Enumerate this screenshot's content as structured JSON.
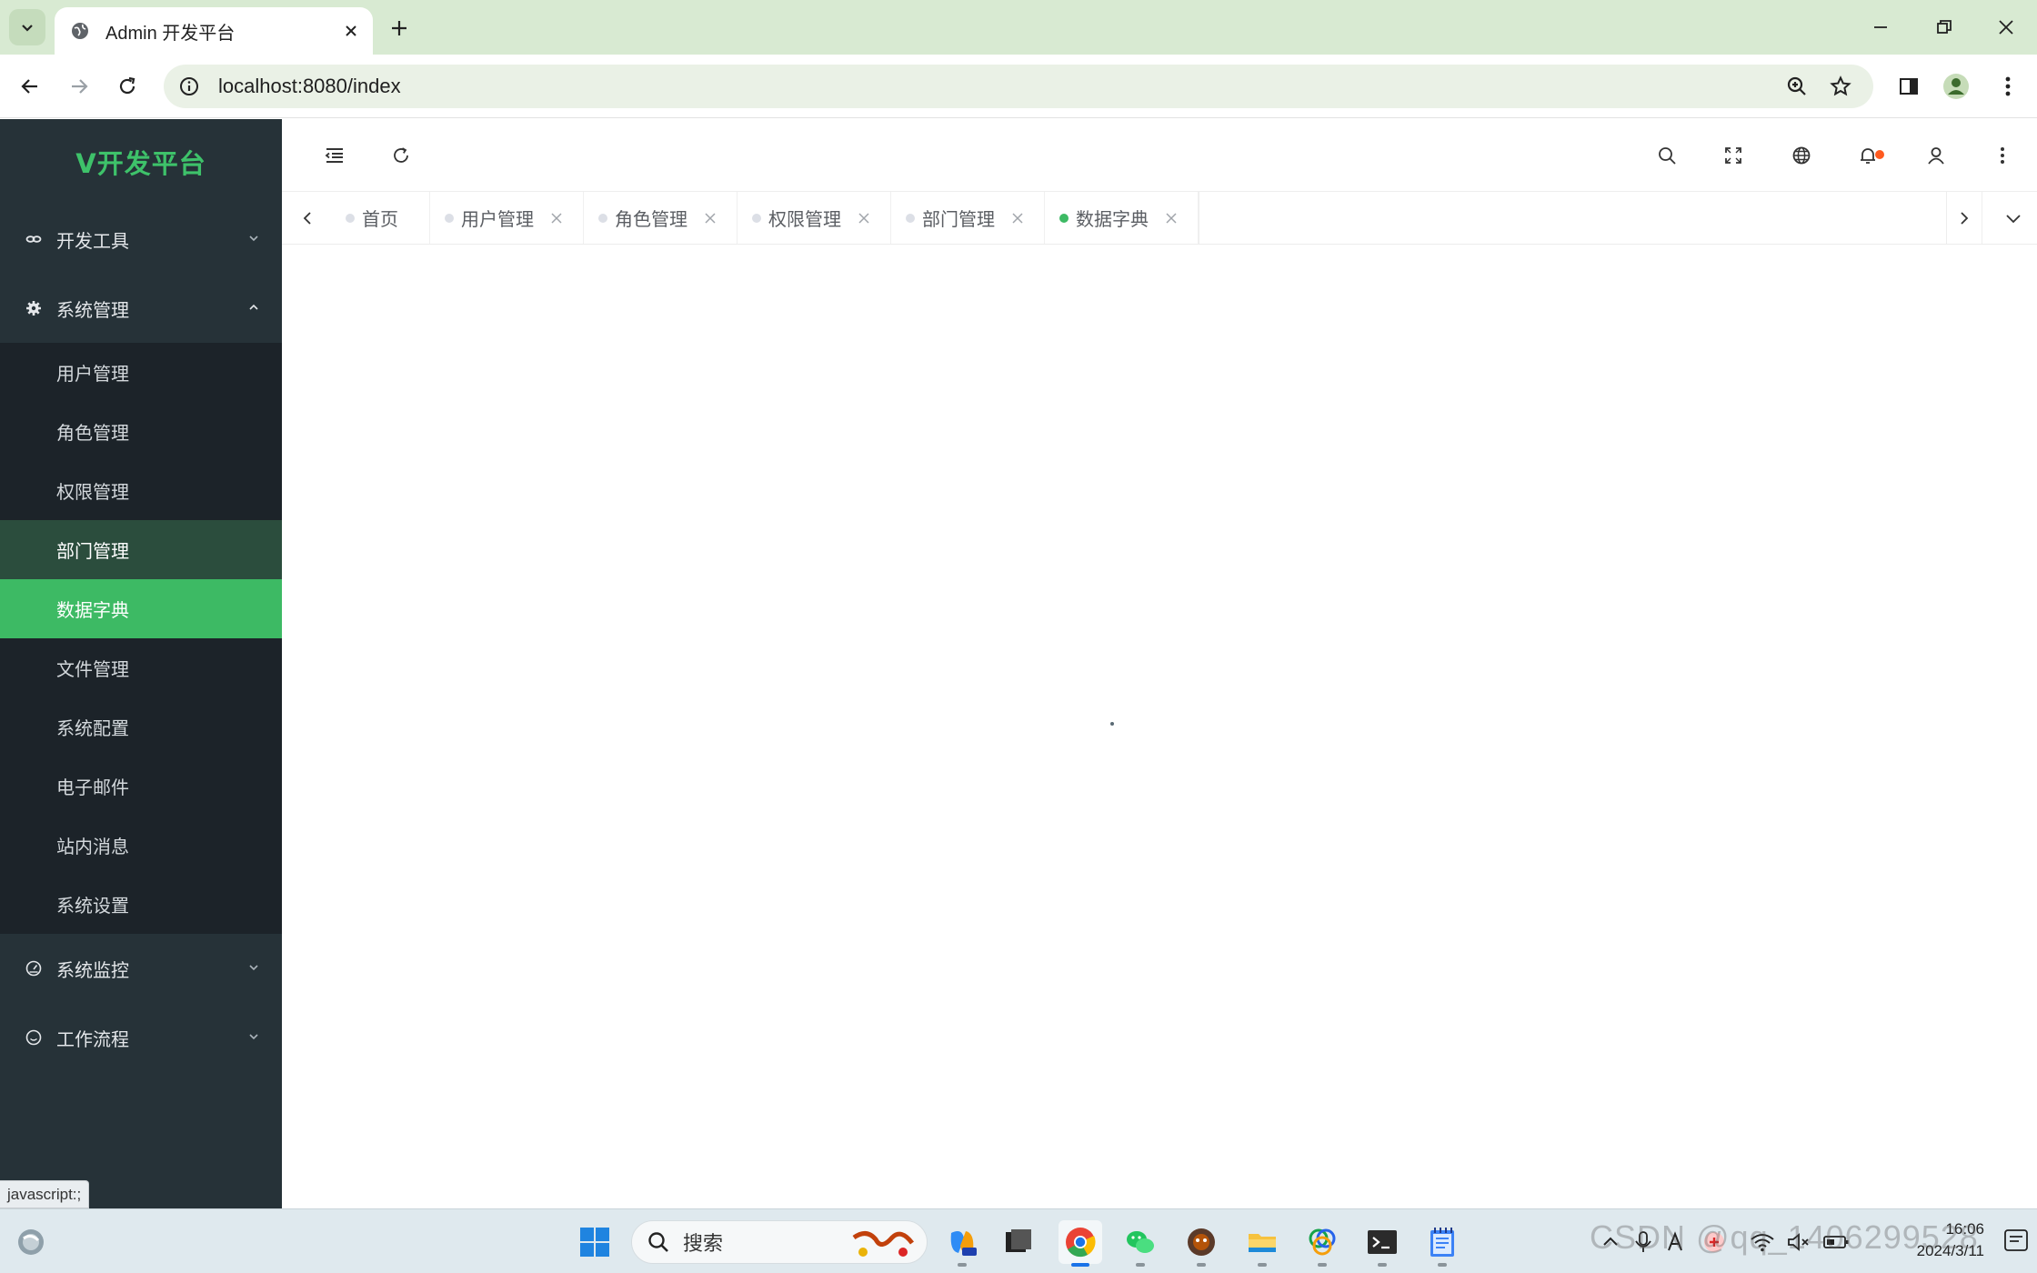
{
  "browser": {
    "tab_title": "Admin 开发平台",
    "url": "localhost:8080/index"
  },
  "sidebar": {
    "logo": "V开发平台",
    "groups": [
      {
        "label": "开发工具",
        "icon": "link-icon",
        "expanded": false
      },
      {
        "label": "系统管理",
        "icon": "gear-icon",
        "expanded": true
      },
      {
        "label": "系统监控",
        "icon": "dashboard-icon",
        "expanded": false
      },
      {
        "label": "工作流程",
        "icon": "smile-icon",
        "expanded": false
      }
    ],
    "system_items": [
      "用户管理",
      "角色管理",
      "权限管理",
      "部门管理",
      "数据字典",
      "文件管理",
      "系统配置",
      "电子邮件",
      "站内消息",
      "系统设置"
    ],
    "active_item": "数据字典",
    "hover_item": "部门管理"
  },
  "tags": [
    {
      "label": "首页",
      "closable": false
    },
    {
      "label": "用户管理",
      "closable": true
    },
    {
      "label": "角色管理",
      "closable": true
    },
    {
      "label": "权限管理",
      "closable": true
    },
    {
      "label": "部门管理",
      "closable": true
    },
    {
      "label": "数据字典",
      "closable": true,
      "active": true
    }
  ],
  "status_hint": "javascript:;",
  "taskbar": {
    "search_placeholder": "搜索",
    "time": "16:06",
    "date": "2024/3/11"
  },
  "watermark": "CSDN @qq_1406299528",
  "colors": {
    "accent": "#3dba64",
    "sidebar_bg": "#263238",
    "submenu_bg": "#1c2329",
    "notification": "#ff5a1f"
  }
}
